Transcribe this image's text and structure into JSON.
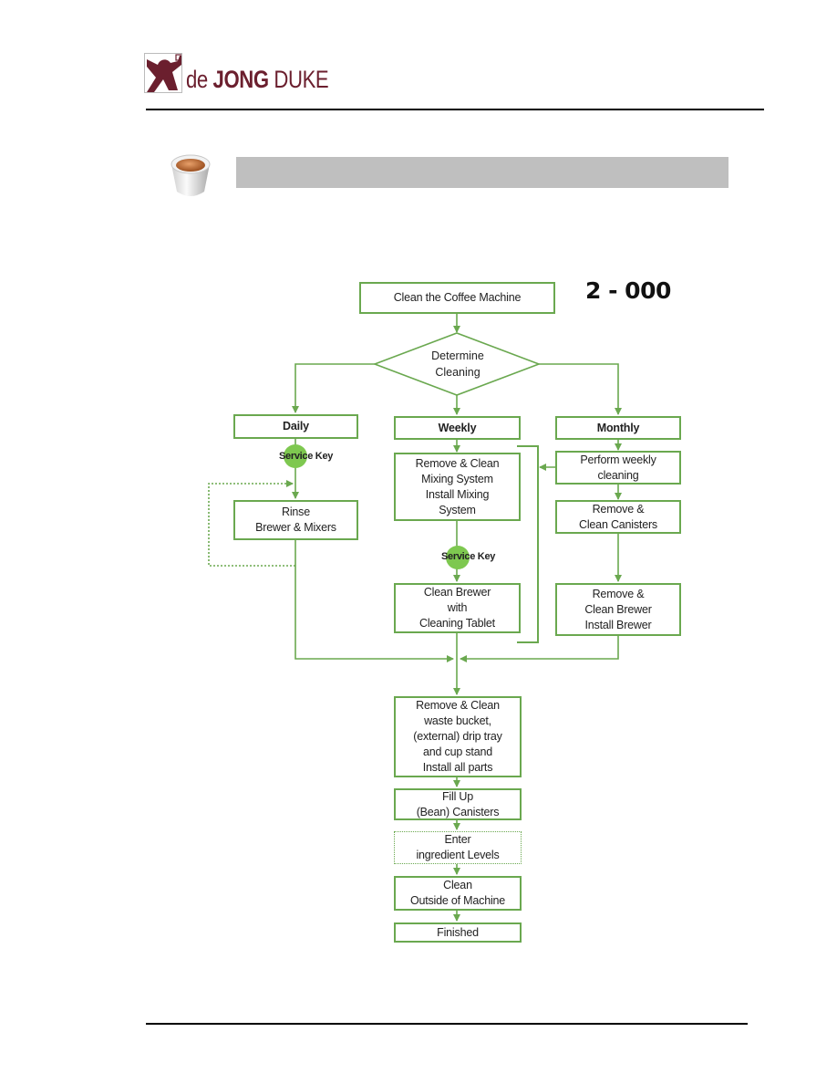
{
  "header": {
    "logo_prefix": "de ",
    "logo_bold": "JONG",
    "logo_suffix": " DUKE",
    "section_icon": "coffee-cup-icon",
    "section_title": ""
  },
  "diagram": {
    "code": "2 - 000",
    "start": "Clean the Coffee Machine",
    "decision": "Determine\nCleaning",
    "branches": {
      "daily": {
        "label": "Daily",
        "service_key": "Service Key",
        "steps": [
          "Rinse\nBrewer & Mixers"
        ]
      },
      "weekly": {
        "label": "Weekly",
        "service_key": "Service Key",
        "steps": [
          "Remove & Clean\nMixing System\nInstall Mixing\nSystem",
          "Clean Brewer\nwith\nCleaning Tablet"
        ]
      },
      "monthly": {
        "label": "Monthly",
        "steps": [
          "Perform weekly\ncleaning",
          "Remove &\nClean Canisters",
          "Remove &\nClean Brewer\nInstall Brewer"
        ]
      }
    },
    "common_steps": [
      "Remove & Clean\nwaste bucket,\n(external) drip tray\nand cup stand\nInstall all parts",
      "Fill Up\n(Bean) Canisters",
      "Enter\ningredient Levels",
      "Clean\nOutside of Machine",
      "Finished"
    ],
    "colors": {
      "line": "#6aa84f",
      "service_key": "#7ec850",
      "title_bar": "#bfbfbf",
      "brand": "#6b1f2e"
    }
  }
}
